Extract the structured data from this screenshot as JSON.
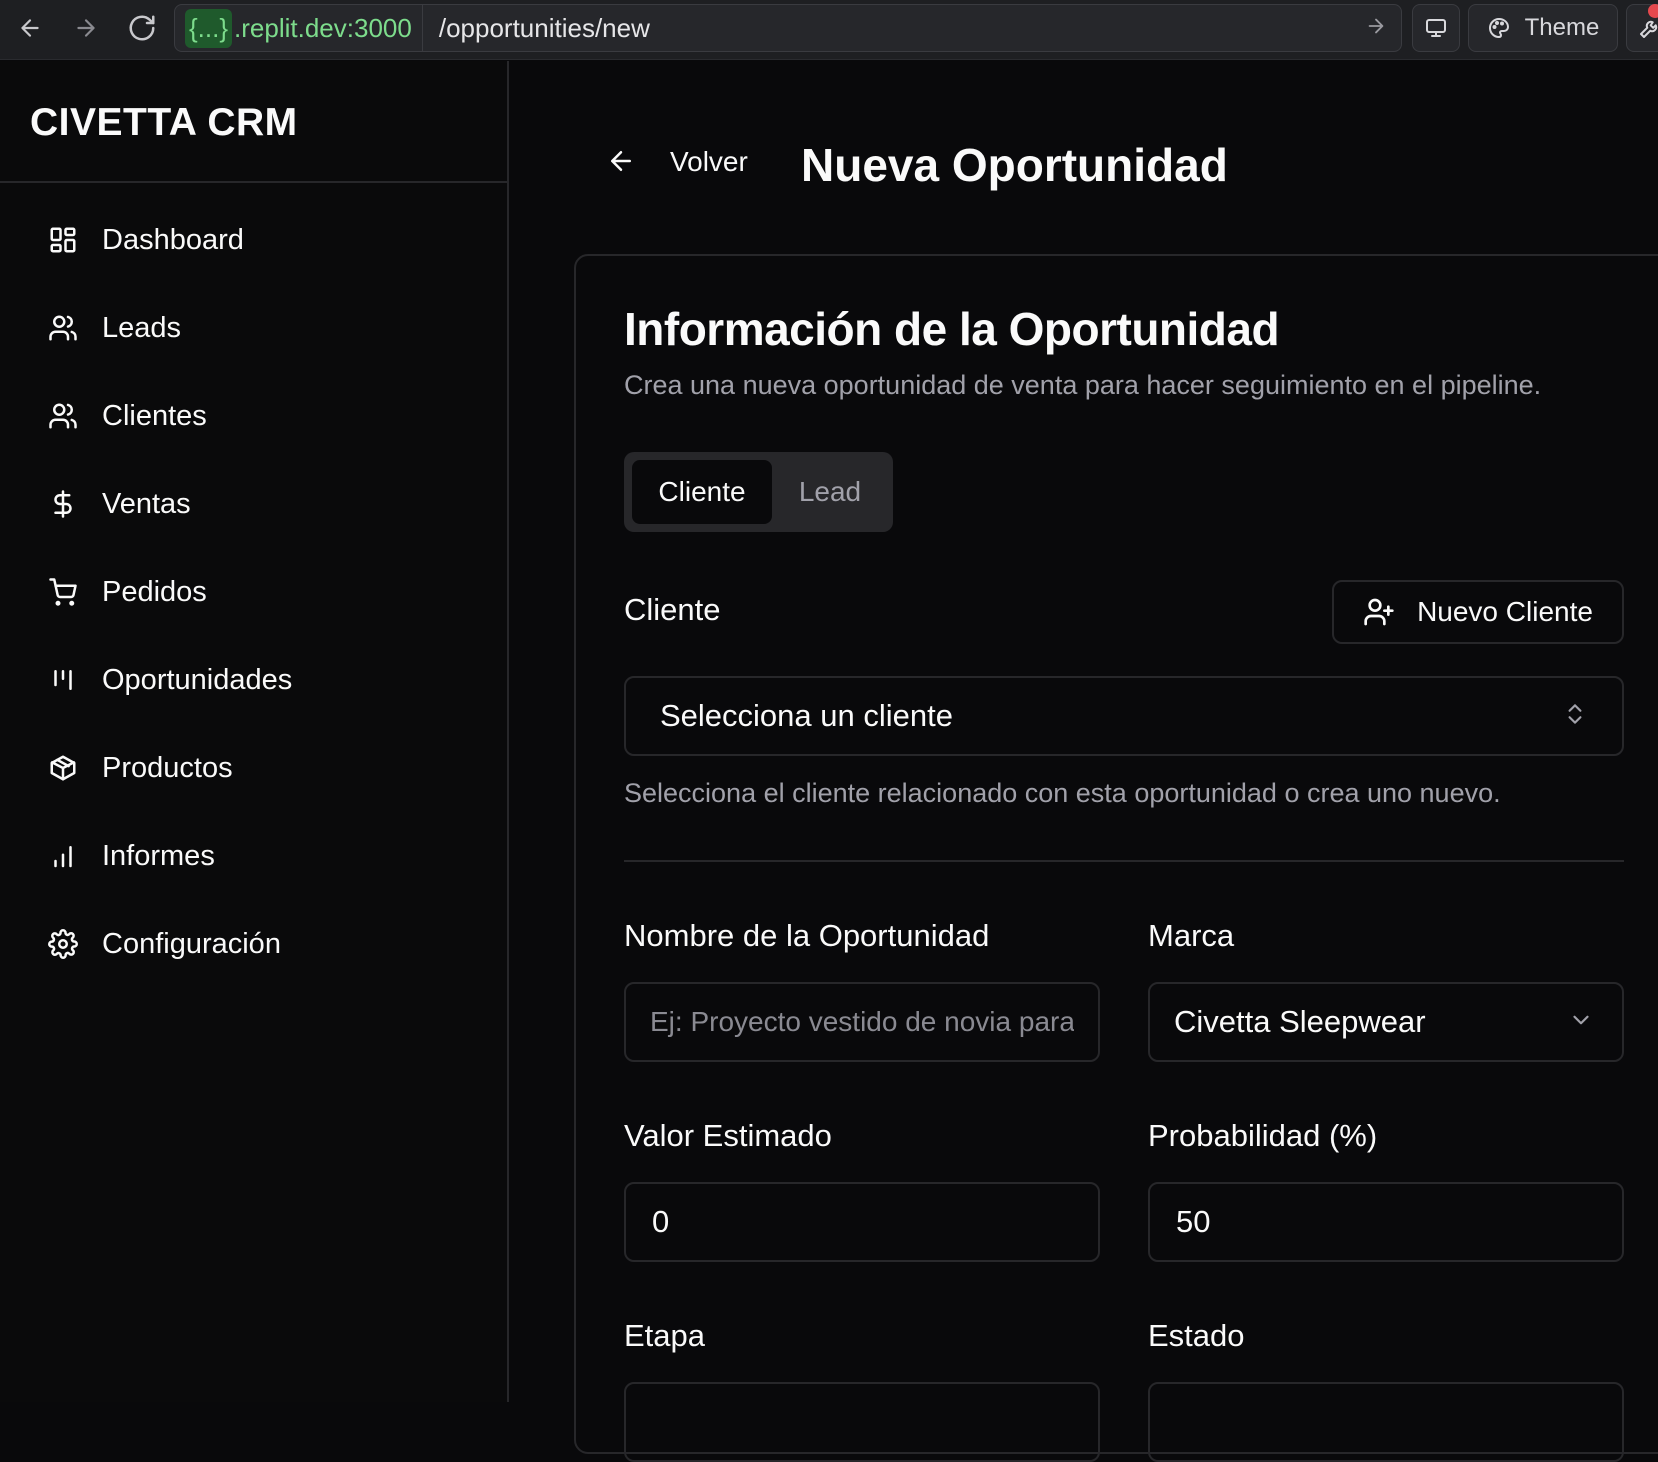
{
  "browser": {
    "url_host_prefix": "{...}",
    "url_host": ".replit.dev:3000",
    "url_path": "/opportunities/new",
    "theme_label": "Theme"
  },
  "sidebar": {
    "brand": "CIVETTA CRM",
    "items": [
      {
        "label": "Dashboard",
        "icon": "dashboard-icon"
      },
      {
        "label": "Leads",
        "icon": "users-icon"
      },
      {
        "label": "Clientes",
        "icon": "users-icon"
      },
      {
        "label": "Ventas",
        "icon": "dollar-icon"
      },
      {
        "label": "Pedidos",
        "icon": "cart-icon"
      },
      {
        "label": "Oportunidades",
        "icon": "kanban-icon"
      },
      {
        "label": "Productos",
        "icon": "package-icon"
      },
      {
        "label": "Informes",
        "icon": "bar-chart-icon"
      },
      {
        "label": "Configuración",
        "icon": "gear-icon"
      }
    ]
  },
  "header": {
    "back_label": "Volver",
    "title": "Nueva Oportunidad"
  },
  "card": {
    "title": "Información de la Oportunidad",
    "description": "Crea una nueva oportunidad de venta para hacer seguimiento en el pipeline.",
    "tabs": {
      "active": "Cliente",
      "inactive": "Lead"
    },
    "client_label": "Cliente",
    "new_client_button": "Nuevo Cliente",
    "client_select_value": "Selecciona un cliente",
    "client_help": "Selecciona el cliente relacionado con esta oportunidad o crea uno nuevo.",
    "name_label": "Nombre de la Oportunidad",
    "name_placeholder": "Ej: Proyecto vestido de novia para",
    "brand_label": "Marca",
    "brand_value": "Civetta Sleepwear",
    "value_label": "Valor Estimado",
    "value": "0",
    "probability_label": "Probabilidad (%)",
    "probability": "50",
    "stage_label": "Etapa",
    "status_label": "Estado"
  },
  "colors": {
    "background": "#09090b",
    "border": "#27272a",
    "muted_text": "#a1a1aa",
    "url_host_green": "#7ddc8c"
  }
}
